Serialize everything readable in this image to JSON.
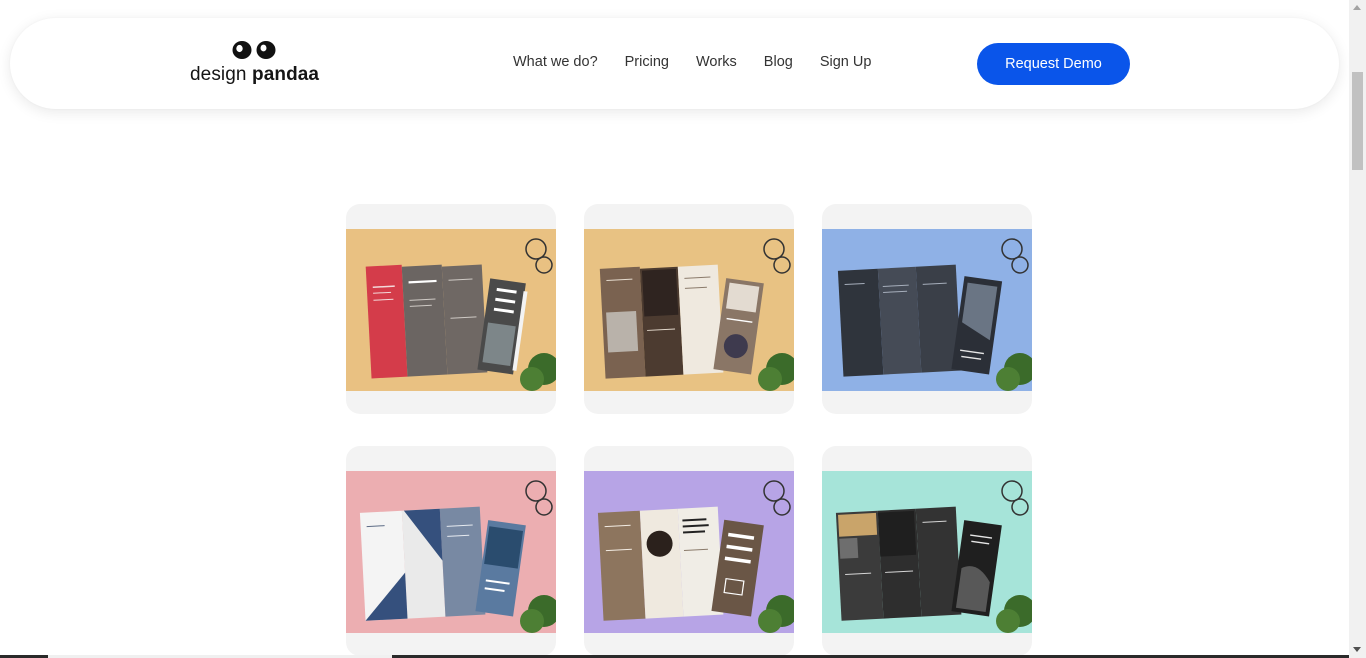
{
  "brand": {
    "logo_light": "design",
    "logo_bold": "pandaa"
  },
  "nav": {
    "items": [
      {
        "label": "What we do?"
      },
      {
        "label": "Pricing"
      },
      {
        "label": "Works"
      },
      {
        "label": "Blog"
      },
      {
        "label": "Sign Up"
      }
    ]
  },
  "cta": {
    "label": "Request Demo",
    "color": "#0a55ea"
  },
  "portfolio": {
    "items": [
      {
        "background": "#e9c182",
        "panel": "#6b6562",
        "accent": "#d43c4a"
      },
      {
        "background": "#e8c283",
        "panel": "#7a6250",
        "accent": "#efe9df"
      },
      {
        "background": "#8fb1e6",
        "panel": "#454b56",
        "accent": "#2f343c"
      },
      {
        "background": "#ecaeb1",
        "panel": "#f4f4f4",
        "accent": "#35507d"
      },
      {
        "background": "#b7a4e6",
        "panel": "#8d755e",
        "accent": "#f0ede6"
      },
      {
        "background": "#a6e4d9",
        "panel": "#3b3b3b",
        "accent": "#1f1f1f"
      }
    ]
  }
}
